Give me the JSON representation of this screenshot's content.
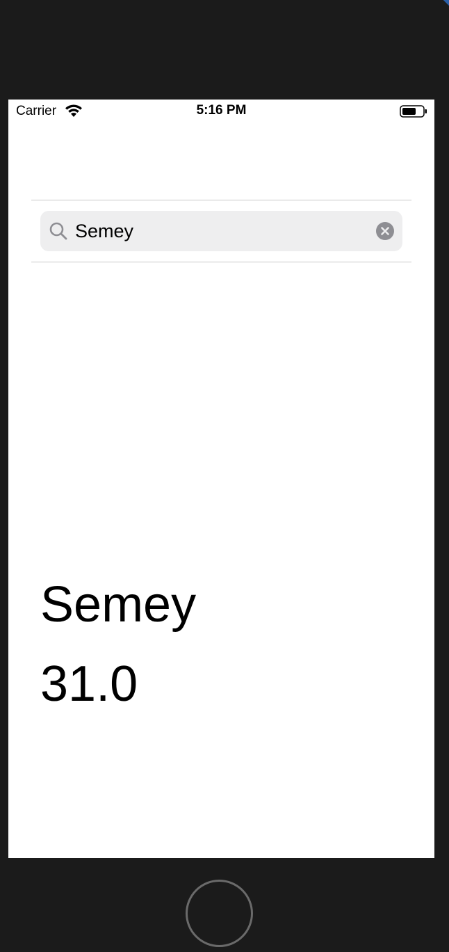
{
  "status_bar": {
    "carrier": "Carrier",
    "time": "5:16 PM",
    "wifi_icon": "wifi-icon",
    "battery_icon": "battery-icon"
  },
  "search": {
    "value": "Semey",
    "placeholder": "",
    "search_icon": "magnifying-glass-icon",
    "clear_icon": "clear-circle-icon"
  },
  "result": {
    "city": "Semey",
    "temperature": "31.0"
  },
  "colors": {
    "device_frame": "#1b1b1b",
    "screen_bg": "#ffffff",
    "search_field_bg": "#eeeeef",
    "icon_gray": "#8e8e93",
    "home_button_ring": "#6a6a6a"
  }
}
